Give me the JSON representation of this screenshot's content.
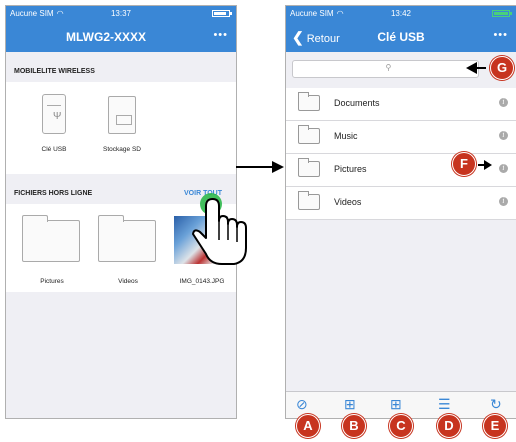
{
  "left_screen": {
    "status": {
      "carrier": "Aucune SIM",
      "time": "13:37"
    },
    "nav": {
      "title": "MLWG2-XXXX",
      "more": "•••"
    },
    "section1": {
      "title": "MOBILELITE WIRELESS"
    },
    "devices": [
      {
        "label": "Clé USB",
        "icon": "usb-drive-icon"
      },
      {
        "label": "Stockage SD",
        "icon": "sd-card-icon"
      }
    ],
    "section2": {
      "title": "FICHIERS HORS LIGNE",
      "link": "VOIR TOUT"
    },
    "offline_items": [
      {
        "label": "Pictures",
        "icon": "folder-icon"
      },
      {
        "label": "Videos",
        "icon": "folder-icon"
      },
      {
        "label": "IMG_0143.JPG",
        "icon": "image-thumbnail"
      }
    ]
  },
  "right_screen": {
    "status": {
      "carrier": "Aucune SIM",
      "time": "13:42"
    },
    "nav": {
      "back": "Retour",
      "title": "Clé USB",
      "more": "•••"
    },
    "folders": [
      {
        "name": "Documents"
      },
      {
        "name": "Music"
      },
      {
        "name": "Pictures"
      },
      {
        "name": "Videos"
      }
    ],
    "toolbar": [
      "select-icon",
      "new-folder-icon",
      "grid-view-icon",
      "sort-icon",
      "refresh-icon"
    ]
  },
  "callouts": {
    "A": "A",
    "B": "B",
    "C": "C",
    "D": "D",
    "E": "E",
    "F": "F",
    "G": "G"
  },
  "colors": {
    "nav_blue": "#3a87d6",
    "badge_red": "#c7341f",
    "tap_green": "#2db84b"
  }
}
